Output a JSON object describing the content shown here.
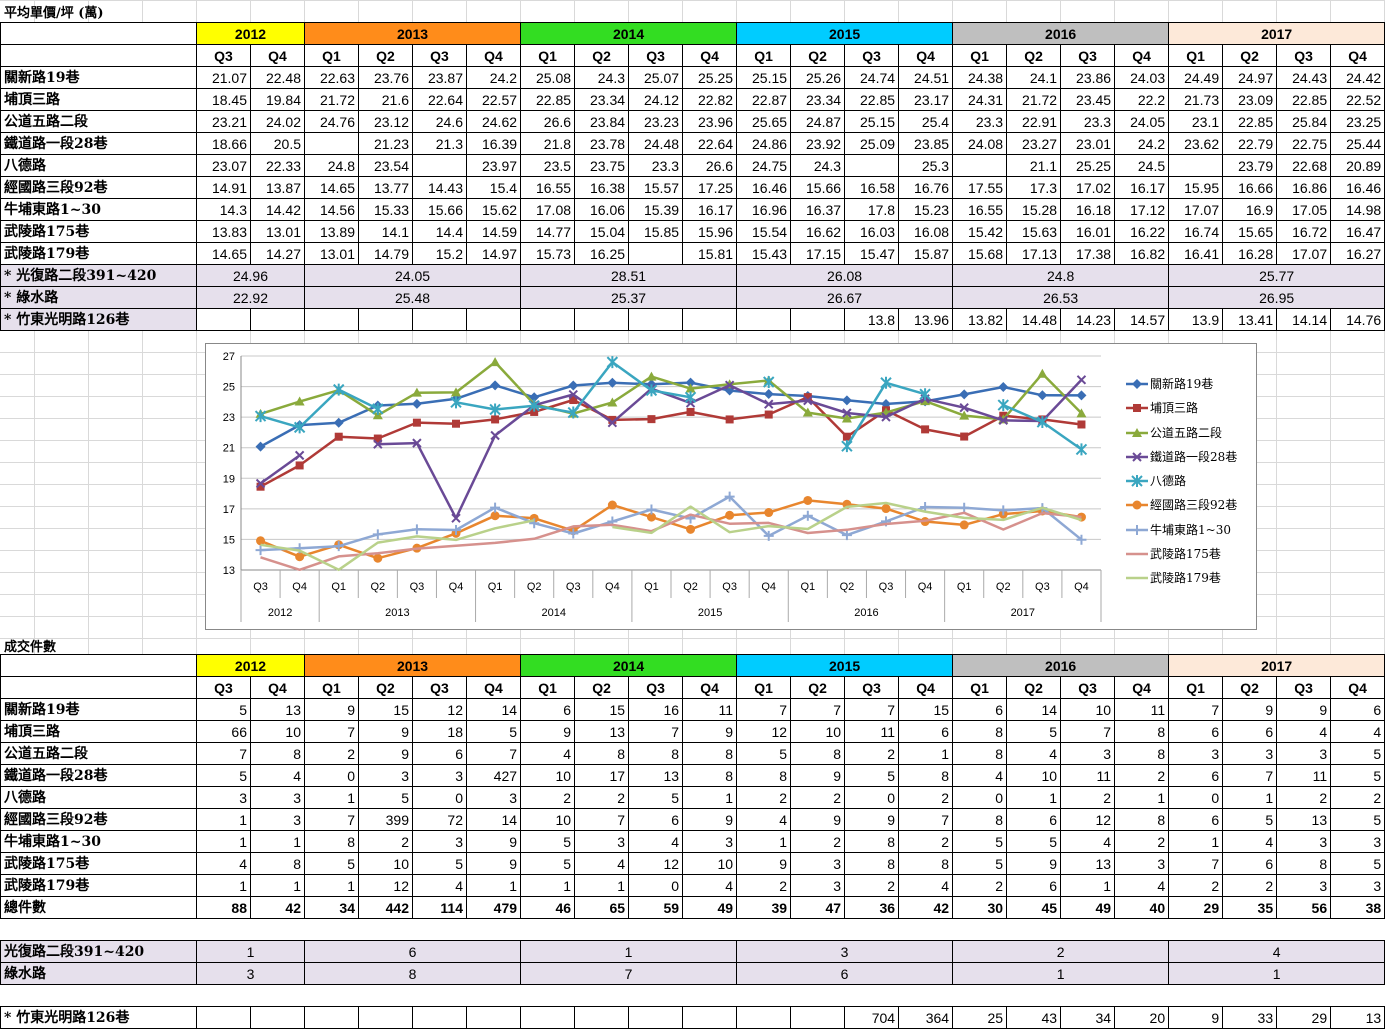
{
  "price_title": "平均單價/坪 (萬)",
  "count_title": "成交件數",
  "years": [
    {
      "label": "2012",
      "color": "#ffff00",
      "quarters": [
        "Q3",
        "Q4"
      ]
    },
    {
      "label": "2013",
      "color": "#ff8c1a",
      "quarters": [
        "Q1",
        "Q2",
        "Q3",
        "Q4"
      ]
    },
    {
      "label": "2014",
      "color": "#33dd22",
      "quarters": [
        "Q1",
        "Q2",
        "Q3",
        "Q4"
      ]
    },
    {
      "label": "2015",
      "color": "#00ccff",
      "quarters": [
        "Q1",
        "Q2",
        "Q3",
        "Q4"
      ]
    },
    {
      "label": "2016",
      "color": "#bfbfbf",
      "quarters": [
        "Q1",
        "Q2",
        "Q3",
        "Q4"
      ]
    },
    {
      "label": "2017",
      "color": "#fde9d9",
      "quarters": [
        "Q1",
        "Q2",
        "Q3",
        "Q4"
      ]
    }
  ],
  "price_rows": [
    {
      "name": "關新路19巷",
      "values": [
        "21.07",
        "22.48",
        "22.63",
        "23.76",
        "23.87",
        "24.2",
        "25.08",
        "24.3",
        "25.07",
        "25.25",
        "25.15",
        "25.26",
        "24.74",
        "24.51",
        "24.38",
        "24.1",
        "23.86",
        "24.03",
        "24.49",
        "24.97",
        "24.43",
        "24.42"
      ]
    },
    {
      "name": "埔頂三路",
      "values": [
        "18.45",
        "19.84",
        "21.72",
        "21.6",
        "22.64",
        "22.57",
        "22.85",
        "23.34",
        "24.12",
        "22.82",
        "22.87",
        "23.34",
        "22.85",
        "23.17",
        "24.31",
        "21.72",
        "23.45",
        "22.2",
        "21.73",
        "23.09",
        "22.85",
        "22.52"
      ]
    },
    {
      "name": "公道五路二段",
      "values": [
        "23.21",
        "24.02",
        "24.76",
        "23.12",
        "24.6",
        "24.62",
        "26.6",
        "23.84",
        "23.23",
        "23.96",
        "25.65",
        "24.87",
        "25.15",
        "25.4",
        "23.3",
        "22.91",
        "23.3",
        "24.05",
        "23.1",
        "22.85",
        "25.84",
        "23.25"
      ]
    },
    {
      "name": "鐵道路一段28巷",
      "values": [
        "18.66",
        "20.5",
        "",
        "21.23",
        "21.3",
        "16.39",
        "21.8",
        "23.78",
        "24.48",
        "22.64",
        "24.86",
        "23.92",
        "25.09",
        "23.85",
        "24.08",
        "23.27",
        "23.01",
        "24.2",
        "23.62",
        "22.79",
        "22.75",
        "25.44"
      ]
    },
    {
      "name": "八德路",
      "values": [
        "23.07",
        "22.33",
        "24.8",
        "23.54",
        "",
        "23.97",
        "23.5",
        "23.75",
        "23.3",
        "26.6",
        "24.75",
        "24.3",
        "",
        "25.3",
        "",
        "21.1",
        "25.25",
        "24.5",
        "",
        "23.79",
        "22.68",
        "20.89"
      ]
    },
    {
      "name": "經國路三段92巷",
      "values": [
        "14.91",
        "13.87",
        "14.65",
        "13.77",
        "14.43",
        "15.4",
        "16.55",
        "16.38",
        "15.57",
        "17.25",
        "16.46",
        "15.66",
        "16.58",
        "16.76",
        "17.55",
        "17.3",
        "17.02",
        "16.17",
        "15.95",
        "16.66",
        "16.86",
        "16.46"
      ]
    },
    {
      "name": "牛埔東路1~30",
      "values": [
        "14.3",
        "14.42",
        "14.56",
        "15.33",
        "15.66",
        "15.62",
        "17.08",
        "16.06",
        "15.39",
        "16.17",
        "16.96",
        "16.37",
        "17.8",
        "15.23",
        "16.55",
        "15.28",
        "16.18",
        "17.12",
        "17.07",
        "16.9",
        "17.05",
        "14.98"
      ]
    },
    {
      "name": "武陵路175巷",
      "values": [
        "13.83",
        "13.01",
        "13.89",
        "14.1",
        "14.4",
        "14.59",
        "14.77",
        "15.04",
        "15.85",
        "15.96",
        "15.54",
        "16.62",
        "16.03",
        "16.08",
        "15.42",
        "15.63",
        "16.01",
        "16.22",
        "16.74",
        "15.65",
        "16.72",
        "16.47"
      ]
    },
    {
      "name": "武陵路179巷",
      "values": [
        "14.65",
        "14.27",
        "13.01",
        "14.79",
        "15.2",
        "14.97",
        "15.73",
        "16.25",
        "",
        "15.81",
        "15.43",
        "17.15",
        "15.47",
        "15.87",
        "15.68",
        "17.13",
        "17.38",
        "16.82",
        "16.41",
        "16.28",
        "17.07",
        "16.27"
      ]
    }
  ],
  "price_year_rows": [
    {
      "name": "* 光復路二段391~420",
      "values": [
        "24.96",
        "24.05",
        "28.51",
        "26.08",
        "24.8",
        "25.77"
      ]
    },
    {
      "name": "* 綠水路",
      "values": [
        "22.92",
        "25.48",
        "25.37",
        "26.67",
        "26.53",
        "26.95"
      ]
    }
  ],
  "price_zhudong": {
    "name": "* 竹東光明路126巷",
    "values": [
      "",
      "",
      "",
      "",
      "",
      "",
      "",
      "",
      "",
      "",
      "",
      "",
      "13.8",
      "13.96",
      "13.82",
      "14.48",
      "14.23",
      "14.57",
      "13.9",
      "13.41",
      "14.14",
      "14.76"
    ]
  },
  "count_rows": [
    {
      "name": "關新路19巷",
      "values": [
        "5",
        "13",
        "9",
        "15",
        "12",
        "14",
        "6",
        "15",
        "16",
        "11",
        "7",
        "7",
        "7",
        "15",
        "6",
        "14",
        "10",
        "11",
        "7",
        "9",
        "9",
        "6"
      ]
    },
    {
      "name": "埔頂三路",
      "values": [
        "66",
        "10",
        "7",
        "9",
        "18",
        "5",
        "9",
        "13",
        "7",
        "9",
        "12",
        "10",
        "11",
        "6",
        "8",
        "5",
        "7",
        "8",
        "6",
        "6",
        "4",
        "4"
      ]
    },
    {
      "name": "公道五路二段",
      "values": [
        "7",
        "8",
        "2",
        "9",
        "6",
        "7",
        "4",
        "8",
        "8",
        "8",
        "5",
        "8",
        "2",
        "1",
        "8",
        "4",
        "3",
        "8",
        "3",
        "3",
        "3",
        "5"
      ]
    },
    {
      "name": "鐵道路一段28巷",
      "values": [
        "5",
        "4",
        "0",
        "3",
        "3",
        "427",
        "10",
        "17",
        "13",
        "8",
        "8",
        "9",
        "5",
        "8",
        "4",
        "10",
        "11",
        "2",
        "6",
        "7",
        "11",
        "5"
      ]
    },
    {
      "name": "八德路",
      "values": [
        "3",
        "3",
        "1",
        "5",
        "0",
        "3",
        "2",
        "2",
        "5",
        "1",
        "2",
        "2",
        "0",
        "2",
        "0",
        "1",
        "2",
        "1",
        "0",
        "1",
        "2",
        "2"
      ]
    },
    {
      "name": "經國路三段92巷",
      "values": [
        "1",
        "3",
        "7",
        "399",
        "72",
        "14",
        "10",
        "7",
        "6",
        "9",
        "4",
        "9",
        "9",
        "7",
        "8",
        "6",
        "12",
        "8",
        "6",
        "5",
        "13",
        "5"
      ]
    },
    {
      "name": "牛埔東路1~30",
      "values": [
        "1",
        "1",
        "8",
        "2",
        "3",
        "9",
        "5",
        "3",
        "4",
        "3",
        "1",
        "2",
        "8",
        "2",
        "5",
        "5",
        "4",
        "2",
        "1",
        "4",
        "3",
        "3"
      ]
    },
    {
      "name": "武陵路175巷",
      "values": [
        "4",
        "8",
        "5",
        "10",
        "5",
        "9",
        "5",
        "4",
        "12",
        "10",
        "9",
        "3",
        "8",
        "8",
        "5",
        "9",
        "13",
        "3",
        "7",
        "6",
        "8",
        "5"
      ]
    },
    {
      "name": "武陵路179巷",
      "values": [
        "1",
        "1",
        "1",
        "12",
        "4",
        "1",
        "1",
        "1",
        "0",
        "4",
        "2",
        "3",
        "2",
        "4",
        "2",
        "6",
        "1",
        "4",
        "2",
        "2",
        "3",
        "3"
      ]
    }
  ],
  "count_total": {
    "name": "總件數",
    "values": [
      "88",
      "42",
      "34",
      "442",
      "114",
      "479",
      "46",
      "65",
      "59",
      "49",
      "39",
      "47",
      "36",
      "42",
      "30",
      "45",
      "49",
      "40",
      "29",
      "35",
      "56",
      "38"
    ]
  },
  "count_year_rows": [
    {
      "name": "光復路二段391~420",
      "values": [
        "1",
        "6",
        "1",
        "3",
        "2",
        "4"
      ]
    },
    {
      "name": "綠水路",
      "values": [
        "3",
        "8",
        "7",
        "6",
        "1",
        "1"
      ]
    }
  ],
  "count_zhudong": {
    "name": "* 竹東光明路126巷",
    "values": [
      "",
      "",
      "",
      "",
      "",
      "",
      "",
      "",
      "",
      "",
      "",
      "",
      "704",
      "364",
      "25",
      "43",
      "34",
      "20",
      "9",
      "33",
      "29",
      "13"
    ]
  },
  "chart_data": {
    "type": "line",
    "title": "",
    "xlabel": "",
    "ylabel": "",
    "ylim": [
      13,
      27
    ],
    "yticks": [
      13,
      15,
      17,
      19,
      21,
      23,
      25,
      27
    ],
    "grid": true,
    "legend": "right",
    "x_quarters": [
      "Q3",
      "Q4",
      "Q1",
      "Q2",
      "Q3",
      "Q4",
      "Q1",
      "Q2",
      "Q3",
      "Q4",
      "Q1",
      "Q2",
      "Q3",
      "Q4",
      "Q1",
      "Q2",
      "Q3",
      "Q4",
      "Q1",
      "Q2",
      "Q3",
      "Q4"
    ],
    "x_years": [
      {
        "label": "2012",
        "span": 2
      },
      {
        "label": "2013",
        "span": 4
      },
      {
        "label": "2014",
        "span": 4
      },
      {
        "label": "2015",
        "span": 4
      },
      {
        "label": "2016",
        "span": 4
      },
      {
        "label": "2017",
        "span": 4
      }
    ],
    "series": [
      {
        "name": "關新路19巷",
        "color": "#3a6eb5",
        "marker": "diamond",
        "values": [
          21.07,
          22.48,
          22.63,
          23.76,
          23.87,
          24.2,
          25.08,
          24.3,
          25.07,
          25.25,
          25.15,
          25.26,
          24.74,
          24.51,
          24.38,
          24.1,
          23.86,
          24.03,
          24.49,
          24.97,
          24.43,
          24.42
        ]
      },
      {
        "name": "埔頂三路",
        "color": "#b03a37",
        "marker": "square",
        "values": [
          18.45,
          19.84,
          21.72,
          21.6,
          22.64,
          22.57,
          22.85,
          23.34,
          24.12,
          22.82,
          22.87,
          23.34,
          22.85,
          23.17,
          24.31,
          21.72,
          23.45,
          22.2,
          21.73,
          23.09,
          22.85,
          22.52
        ]
      },
      {
        "name": "公道五路二段",
        "color": "#8aaa3c",
        "marker": "triangle",
        "values": [
          23.21,
          24.02,
          24.76,
          23.12,
          24.6,
          24.62,
          26.6,
          23.84,
          23.23,
          23.96,
          25.65,
          24.87,
          25.15,
          25.4,
          23.3,
          22.91,
          23.3,
          24.05,
          23.1,
          22.85,
          25.84,
          23.25
        ]
      },
      {
        "name": "鐵道路一段28巷",
        "color": "#6a4a96",
        "marker": "x",
        "values": [
          18.66,
          20.5,
          null,
          21.23,
          21.3,
          16.39,
          21.8,
          23.78,
          24.48,
          22.64,
          24.86,
          23.92,
          25.09,
          23.85,
          24.08,
          23.27,
          23.01,
          24.2,
          23.62,
          22.79,
          22.75,
          25.44
        ]
      },
      {
        "name": "八德路",
        "color": "#3aa6c0",
        "marker": "star",
        "values": [
          23.07,
          22.33,
          24.8,
          23.54,
          null,
          23.97,
          23.5,
          23.75,
          23.3,
          26.6,
          24.75,
          24.3,
          null,
          25.3,
          null,
          21.1,
          25.25,
          24.5,
          null,
          23.79,
          22.68,
          20.89
        ]
      },
      {
        "name": "經國路三段92巷",
        "color": "#e8862e",
        "marker": "circle",
        "values": [
          14.91,
          13.87,
          14.65,
          13.77,
          14.43,
          15.4,
          16.55,
          16.38,
          15.57,
          17.25,
          16.46,
          15.66,
          16.58,
          16.76,
          17.55,
          17.3,
          17.02,
          16.17,
          15.95,
          16.66,
          16.86,
          16.46
        ]
      },
      {
        "name": "牛埔東路1~30",
        "color": "#8ea8d4",
        "marker": "plus",
        "values": [
          14.3,
          14.42,
          14.56,
          15.33,
          15.66,
          15.62,
          17.08,
          16.06,
          15.39,
          16.17,
          16.96,
          16.37,
          17.8,
          15.23,
          16.55,
          15.28,
          16.18,
          17.12,
          17.07,
          16.9,
          17.05,
          14.98
        ]
      },
      {
        "name": "武陵路175巷",
        "color": "#d6918d",
        "marker": "none",
        "values": [
          13.83,
          13.01,
          13.89,
          14.1,
          14.4,
          14.59,
          14.77,
          15.04,
          15.85,
          15.96,
          15.54,
          16.62,
          16.03,
          16.08,
          15.42,
          15.63,
          16.01,
          16.22,
          16.74,
          15.65,
          16.72,
          16.47
        ]
      },
      {
        "name": "武陵路179巷",
        "color": "#b9d18a",
        "marker": "none",
        "values": [
          14.65,
          14.27,
          13.01,
          14.79,
          15.2,
          14.97,
          15.73,
          16.25,
          null,
          15.81,
          15.43,
          17.15,
          15.47,
          15.87,
          15.68,
          17.13,
          17.38,
          16.82,
          16.41,
          16.28,
          17.07,
          16.27
        ]
      }
    ]
  }
}
